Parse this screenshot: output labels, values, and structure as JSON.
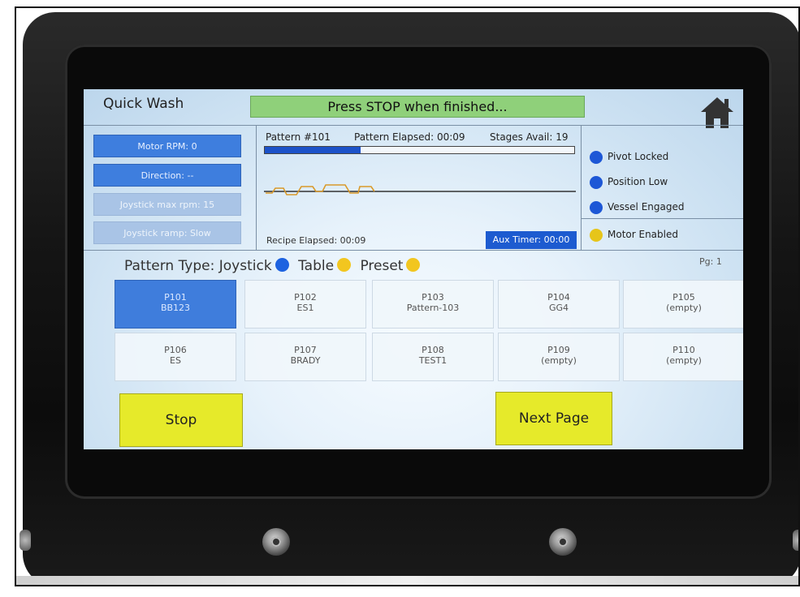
{
  "screen": {
    "app_title": "Quick Wash",
    "status_message": "Press STOP when finished...",
    "home_icon": "home-icon"
  },
  "left_panel": {
    "motor_rpm": "Motor RPM: 0",
    "direction": "Direction: --",
    "joystick_maxrpm": "Joystick max rpm: 15",
    "joystick_ramp": "Joystick ramp: Slow"
  },
  "pattern_panel": {
    "pattern_no": "Pattern #101",
    "pattern_elapsed": "Pattern Elapsed: 00:09",
    "stages_avail": "Stages Avail: 19",
    "progress_fraction": 0.31,
    "recipe_elapsed": "Recipe Elapsed: 00:09",
    "aux_timer": "Aux Timer: 00:00"
  },
  "indicators": [
    {
      "label": "Pivot Locked",
      "color": "#1d57d6"
    },
    {
      "label": "Position Low",
      "color": "#1d57d6"
    },
    {
      "label": "Vessel Engaged",
      "color": "#1d57d6"
    },
    {
      "label": "Motor Enabled",
      "color": "#e6c51a"
    }
  ],
  "pattern_type": {
    "label": "Pattern Type:",
    "options": [
      {
        "label": "Joystick",
        "color": "#1d62e0"
      },
      {
        "label": "Table",
        "color": "#f2c61f"
      },
      {
        "label": "Preset",
        "color": "#f2c61f"
      }
    ],
    "page": "Pg: 1"
  },
  "patterns": [
    {
      "id": "P101",
      "name": "BB123",
      "selected": true
    },
    {
      "id": "P102",
      "name": "ES1"
    },
    {
      "id": "P103",
      "name": "Pattern-103"
    },
    {
      "id": "P104",
      "name": "GG4"
    },
    {
      "id": "P105",
      "name": "(empty)"
    },
    {
      "id": "P106",
      "name": "ES"
    },
    {
      "id": "P107",
      "name": "BRADY"
    },
    {
      "id": "P108",
      "name": "TEST1"
    },
    {
      "id": "P109",
      "name": "(empty)"
    },
    {
      "id": "P110",
      "name": "(empty)"
    }
  ],
  "buttons": {
    "stop": "Stop",
    "next_page": "Next Page"
  },
  "colors": {
    "status_green": "#8fd07a",
    "button_blue": "#3e7ede",
    "button_yellow": "#e6ea2a",
    "progress_blue": "#1c52c9"
  }
}
